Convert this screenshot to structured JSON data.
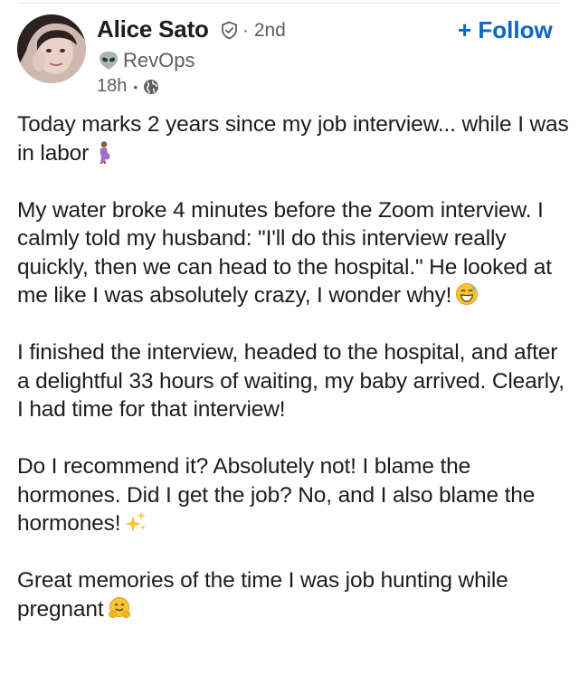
{
  "author": {
    "name": "Alice Sato",
    "degree": "· 2nd",
    "headline": "RevOps",
    "time": "18h",
    "meta_separator": "•"
  },
  "follow_label": "+ Follow",
  "icons": {
    "verified": "verified-shield-icon",
    "headline": "alien-emoji-icon",
    "visibility": "globe-icon"
  },
  "accent_color": "#0a66c2",
  "post": {
    "p1": "Today marks 2 years since my job interview... while I was in labor",
    "p2": "My water broke 4 minutes before the Zoom interview. I calmly told my husband: \"I'll do this interview really quickly,  then we can head to the hospital.\" He looked at me like I was absolutely crazy, I wonder why!",
    "p3": "I finished the interview, headed to the hospital, and after a delightful 33 hours of waiting, my baby arrived. Clearly, I had time for that interview!",
    "p4": "Do I recommend it? Absolutely not! I blame the hormones. Did I get the job? No, and I also blame the hormones!",
    "p5": "Great memories of the time I was job hunting while pregnant",
    "emojis": [
      "pregnant-person-emoji",
      "grinning-sweat-emoji",
      "sparkles-emoji",
      "hugging-face-emoji"
    ]
  }
}
